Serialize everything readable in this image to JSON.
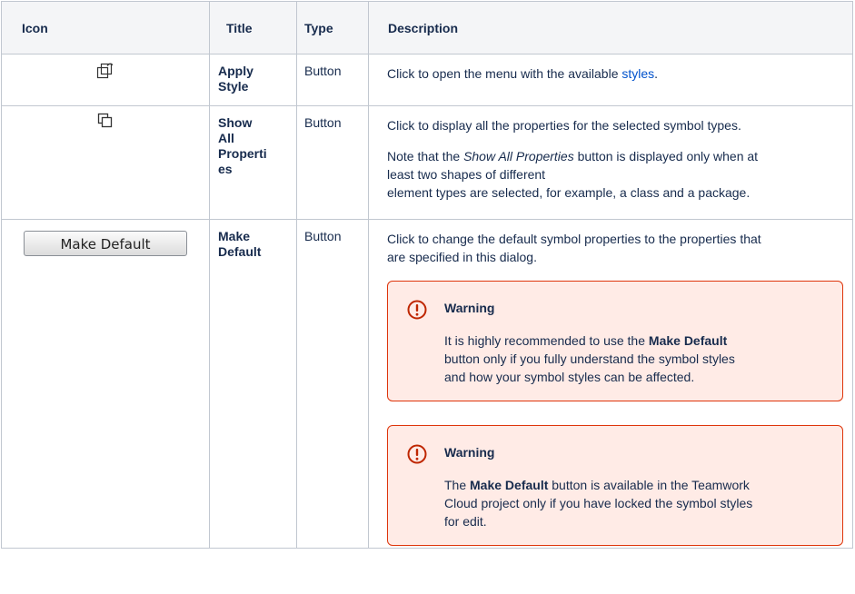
{
  "headers": {
    "icon": "Icon",
    "title": "Title",
    "type": "Type",
    "description": "Description"
  },
  "rows": [
    {
      "title_lines": [
        "Apply",
        "Style"
      ],
      "type": "Button",
      "desc_before": "Click to open the menu with the available ",
      "desc_link": "styles",
      "desc_after": "."
    },
    {
      "title_lines": [
        "Show",
        "All",
        "Properti",
        "es"
      ],
      "type": "Button",
      "desc": "Click to display all the properties for the selected symbol types.",
      "note_prefix": "Note that the ",
      "note_italic": "Show All Properties",
      "note_line1_rest": " button is displayed only when at",
      "note_line2": "least two shapes of different",
      "note_line3": "element types are selected, for example, a class and a package."
    },
    {
      "button_label": "Make Default",
      "title_lines": [
        "Make",
        "Default"
      ],
      "type": "Button",
      "desc_line1": "Click to change the default symbol properties to the properties that",
      "desc_line2": "are specified in this dialog.",
      "warnings": [
        {
          "title": "Warning",
          "line1_prefix": "It is highly recommended to use the ",
          "line1_bold": "Make Default",
          "line2": "button only if you fully understand the symbol styles",
          "line3": "and how your symbol styles can be affected."
        },
        {
          "title": "Warning",
          "line1_prefix": "The ",
          "line1_bold": "Make Default",
          "line1_suffix": " button is available in the Teamwork",
          "line2": "Cloud project only if you have locked the symbol styles",
          "line3": "for edit."
        }
      ]
    }
  ],
  "colors": {
    "warning_border": "#de350b",
    "warning_bg": "#ffebe6",
    "warning_icon": "#bf2600",
    "link": "#0052cc",
    "header_bg": "#f4f5f7"
  },
  "icons": [
    "apply-style-icon",
    "show-all-properties-icon",
    "error-icon"
  ]
}
